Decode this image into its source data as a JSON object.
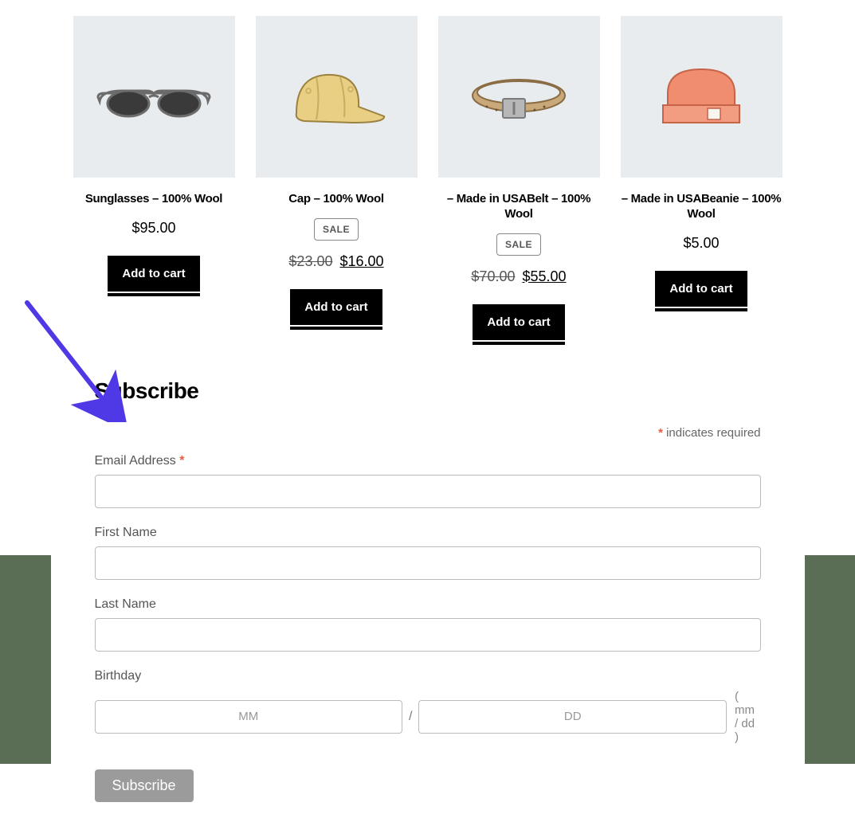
{
  "products": [
    {
      "title": "Sunglasses – 100% Wool",
      "price": "$95.00",
      "cta": "Add to cart"
    },
    {
      "title": "Cap – 100% Wool",
      "sale_label": "SALE",
      "price_old": "$23.00",
      "price_new": "$16.00",
      "cta": "Add to cart"
    },
    {
      "title": "– Made in USABelt – 100% Wool",
      "sale_label": "SALE",
      "price_old": "$70.00",
      "price_new": "$55.00",
      "cta": "Add to cart"
    },
    {
      "title": "– Made in USABeanie – 100% Wool",
      "price": "$5.00",
      "cta": "Add to cart"
    }
  ],
  "subscribe": {
    "heading": "Subscribe",
    "required_note": "indicates required",
    "email_label": "Email Address",
    "first_name_label": "First Name",
    "last_name_label": "Last Name",
    "birthday_label": "Birthday",
    "mm_placeholder": "MM",
    "dd_placeholder": "DD",
    "slash": "/",
    "date_hint": "( mm / dd )",
    "button_label": "Subscribe",
    "asterisk": "*"
  }
}
